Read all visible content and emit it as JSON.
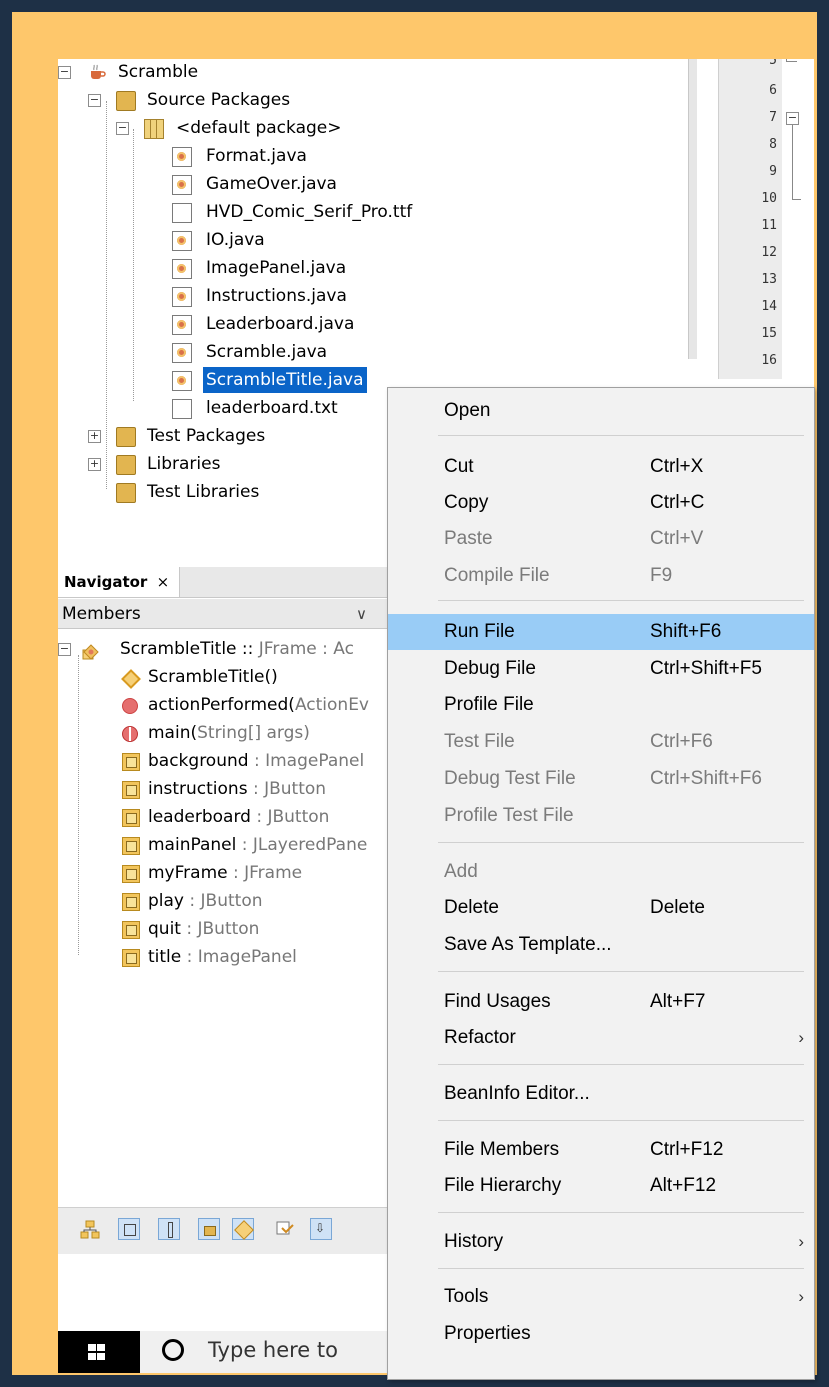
{
  "project_tree": {
    "root": "Scramble",
    "source_packages": "Source Packages",
    "default_package": "<default package>",
    "files": [
      "Format.java",
      "GameOver.java",
      "HVD_Comic_Serif_Pro.ttf",
      "IO.java",
      "ImagePanel.java",
      "Instructions.java",
      "Leaderboard.java",
      "Scramble.java",
      "ScrambleTitle.java",
      "leaderboard.txt"
    ],
    "test_packages": "Test Packages",
    "libraries": "Libraries",
    "test_libraries": "Test Libraries",
    "expand_collapsed": "+",
    "expand_open": "−"
  },
  "editor": {
    "line_numbers": [
      "5",
      "6",
      "7",
      "8",
      "9",
      "10",
      "11",
      "12",
      "13",
      "14",
      "15",
      "16"
    ],
    "fold_marker": "−"
  },
  "navigator": {
    "tab_label": "Navigator",
    "close_glyph": "×",
    "filter_label": "Members",
    "filter_chevron": "∨",
    "class_row": {
      "name": "ScrambleTitle",
      "sep": " :: ",
      "type": "JFrame : Ac"
    },
    "members": [
      {
        "name": "ScrambleTitle()",
        "type": ""
      },
      {
        "name": "actionPerformed(",
        "type": "ActionEv"
      },
      {
        "name": "main(",
        "type": "String[] args)"
      },
      {
        "name": "background",
        "type": " : ImagePanel"
      },
      {
        "name": "instructions",
        "type": " : JButton"
      },
      {
        "name": "leaderboard",
        "type": " : JButton"
      },
      {
        "name": "mainPanel",
        "type": " : JLayeredPane"
      },
      {
        "name": "myFrame",
        "type": " : JFrame"
      },
      {
        "name": "play",
        "type": " : JButton"
      },
      {
        "name": "quit",
        "type": " : JButton"
      },
      {
        "name": "title",
        "type": " : ImagePanel"
      }
    ]
  },
  "taskbar": {
    "search_placeholder": "Type here to"
  },
  "context_menu": {
    "items": [
      {
        "label": "Open",
        "shortcut": "",
        "disabled": false
      },
      {
        "label": "Cut",
        "shortcut": "Ctrl+X",
        "disabled": false
      },
      {
        "label": "Copy",
        "shortcut": "Ctrl+C",
        "disabled": false
      },
      {
        "label": "Paste",
        "shortcut": "Ctrl+V",
        "disabled": true
      },
      {
        "label": "Compile File",
        "shortcut": "F9",
        "disabled": true
      },
      {
        "label": "Run File",
        "shortcut": "Shift+F6",
        "disabled": false,
        "highlighted": true
      },
      {
        "label": "Debug File",
        "shortcut": "Ctrl+Shift+F5",
        "disabled": false
      },
      {
        "label": "Profile File",
        "shortcut": "",
        "disabled": false
      },
      {
        "label": "Test File",
        "shortcut": "Ctrl+F6",
        "disabled": true
      },
      {
        "label": "Debug Test File",
        "shortcut": "Ctrl+Shift+F6",
        "disabled": true
      },
      {
        "label": "Profile Test File",
        "shortcut": "",
        "disabled": true
      },
      {
        "label": "Add",
        "shortcut": "",
        "disabled": true
      },
      {
        "label": "Delete",
        "shortcut": "Delete",
        "disabled": false
      },
      {
        "label": "Save As Template...",
        "shortcut": "",
        "disabled": false
      },
      {
        "label": "Find Usages",
        "shortcut": "Alt+F7",
        "disabled": false
      },
      {
        "label": "Refactor",
        "shortcut": "",
        "disabled": false,
        "submenu": true
      },
      {
        "label": "BeanInfo Editor...",
        "shortcut": "",
        "disabled": false
      },
      {
        "label": "File Members",
        "shortcut": "Ctrl+F12",
        "disabled": false
      },
      {
        "label": "File Hierarchy",
        "shortcut": "Alt+F12",
        "disabled": false
      },
      {
        "label": "History",
        "shortcut": "",
        "disabled": false,
        "submenu": true
      },
      {
        "label": "Tools",
        "shortcut": "",
        "disabled": false,
        "submenu": true
      },
      {
        "label": "Properties",
        "shortcut": "",
        "disabled": false
      }
    ],
    "submenu_arrow": "›"
  },
  "colors": {
    "frame": "#fec76b",
    "background": "#1e3046",
    "selection": "#0a64c8",
    "menu_highlight": "#99ccf6"
  }
}
